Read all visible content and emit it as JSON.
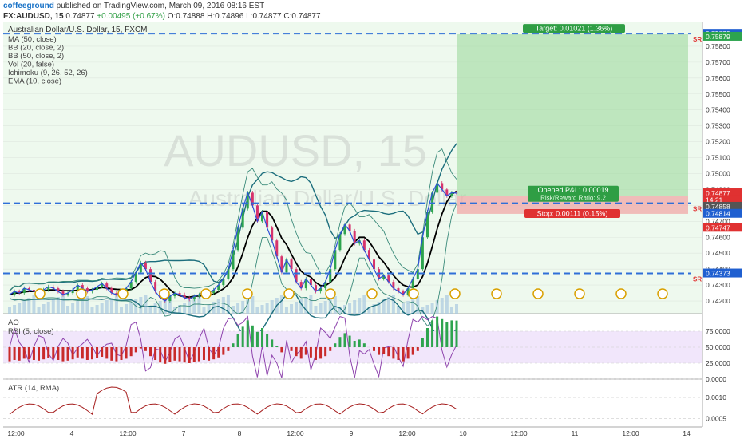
{
  "header": {
    "author": "coffeeground",
    "published": "published on TradingView.com, March 09, 2016 08:16 EST",
    "symbol": "FX:AUDUSD, 15",
    "last": "0.74877",
    "change": "+0.00495 (+0.67%)",
    "ohlc": "O:0.74888 H:0.74896 L:0.74877 C:0.74877"
  },
  "chart_data": {
    "type": "candlestick",
    "title": "Australian Dollar/U.S. Dollar, 15, FXCM",
    "watermark_symbol": "AUDUSD, 15",
    "watermark_name": "Australian Dollar/U.S. Dollar",
    "studies": [
      "MA (50, close)",
      "BB (20, close, 2)",
      "BB (50, close, 2)",
      "Vol (20, false)",
      "Ichimoku (9, 26, 52, 26)",
      "EMA (10, close)"
    ],
    "price_ticks": [
      "0.75800",
      "0.75700",
      "0.75600",
      "0.75500",
      "0.75400",
      "0.75300",
      "0.75200",
      "0.75100",
      "0.75000",
      "0.74900",
      "0.74800",
      "0.74700",
      "0.74600",
      "0.74500",
      "0.74400",
      "0.74300",
      "0.74200"
    ],
    "price_range": [
      0.7412,
      0.7595
    ],
    "sr_levels": [
      0.75879,
      0.74814,
      0.74373
    ],
    "sr_label": "SR",
    "position": {
      "entry": 0.74858,
      "target_price": 0.75879,
      "stop_price": 0.74747,
      "target_label": "Target: 0.01021 (1.36%)",
      "stop_label": "Stop: 0.00111 (0.15%)",
      "pnl_label": "Opened P&L: 0.00019",
      "rr_label": "Risk/Reward Ratio: 9.2"
    },
    "price_tags": [
      {
        "text": "0.75879",
        "value": 0.75879,
        "color": "#1f5fd0"
      },
      {
        "text": "0.75879",
        "value": 0.7586,
        "color": "#2da44e"
      },
      {
        "text": "0.74877",
        "value": 0.74877,
        "color": "#e03131"
      },
      {
        "text": "14:21",
        "value": 0.74835,
        "color": "#e03131"
      },
      {
        "text": "0.74858",
        "value": 0.74792,
        "color": "#555555"
      },
      {
        "text": "0.74814",
        "value": 0.74748,
        "color": "#1f5fd0"
      },
      {
        "text": "0.74747",
        "value": 0.7466,
        "color": "#e03131"
      },
      {
        "text": "0.74373",
        "value": 0.74373,
        "color": "#1f5fd0"
      }
    ],
    "close_series": [
      0.7424,
      0.7426,
      0.7425,
      0.7428,
      0.7427,
      0.7426,
      0.7425,
      0.7427,
      0.7429,
      0.7428,
      0.7426,
      0.7424,
      0.7425,
      0.7427,
      0.743,
      0.7428,
      0.7426,
      0.7427,
      0.7429,
      0.7431,
      0.7428,
      0.7425,
      0.7424,
      0.7426,
      0.7428,
      0.7432,
      0.7438,
      0.7444,
      0.744,
      0.7432,
      0.7426,
      0.7422,
      0.742,
      0.7423,
      0.7425,
      0.7424,
      0.7422,
      0.7421,
      0.7423,
      0.7424,
      0.7426,
      0.7425,
      0.7427,
      0.743,
      0.7434,
      0.744,
      0.7452,
      0.7466,
      0.7478,
      0.7488,
      0.748,
      0.747,
      0.7476,
      0.7466,
      0.7458,
      0.7448,
      0.7438,
      0.7446,
      0.744,
      0.7432,
      0.7428,
      0.7434,
      0.743,
      0.7426,
      0.7428,
      0.7432,
      0.744,
      0.7452,
      0.7462,
      0.7468,
      0.7464,
      0.7456,
      0.7458,
      0.7452,
      0.7446,
      0.744,
      0.7434,
      0.7436,
      0.7432,
      0.7428,
      0.7426,
      0.7424,
      0.7428,
      0.7434,
      0.744,
      0.746,
      0.7476,
      0.7488,
      0.7494,
      0.749,
      0.7486,
      0.7488,
      0.74877
    ],
    "rsi_axis": [
      "75.0000",
      "50.0000",
      "25.0000",
      "0.0000"
    ],
    "rsi_label": "AO",
    "rsi_label2": "RSI (5, close)",
    "atr_label": "ATR (14, RMA)",
    "atr_axis": [
      "0.0010",
      "0.0005"
    ],
    "x_ticks": [
      "12:00",
      "4",
      "12:00",
      "7",
      "8",
      "12:00",
      "9",
      "12:00",
      "10",
      "12:00",
      "11",
      "12:00",
      "14"
    ]
  }
}
